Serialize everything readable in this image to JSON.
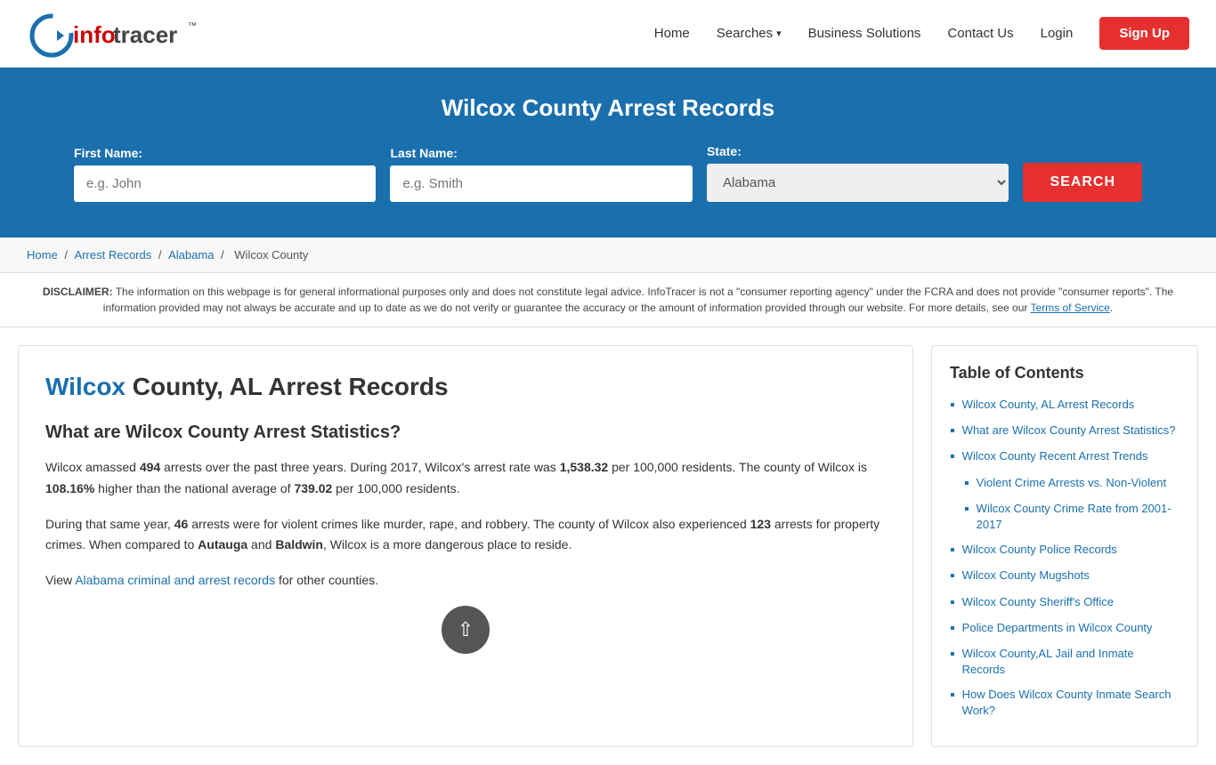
{
  "header": {
    "logo_text_info": "info",
    "logo_text_tracer": "tracer",
    "logo_tm": "™",
    "nav": {
      "home": "Home",
      "searches": "Searches",
      "business_solutions": "Business Solutions",
      "contact_us": "Contact Us",
      "login": "Login",
      "signup": "Sign Up"
    }
  },
  "hero": {
    "title": "Wilcox County Arrest Records",
    "form": {
      "first_name_label": "First Name:",
      "first_name_placeholder": "e.g. John",
      "last_name_label": "Last Name:",
      "last_name_placeholder": "e.g. Smith",
      "state_label": "State:",
      "state_default": "Alabama",
      "search_button": "SEARCH"
    }
  },
  "breadcrumb": {
    "home": "Home",
    "arrest_records": "Arrest Records",
    "alabama": "Alabama",
    "wilcox_county": "Wilcox County"
  },
  "disclaimer": {
    "label": "DISCLAIMER:",
    "text": "The information on this webpage is for general informational purposes only and does not constitute legal advice. InfoTracer is not a \"consumer reporting agency\" under the FCRA and does not provide \"consumer reports\". The information provided may not always be accurate and up to date as we do not verify or guarantee the accuracy or the amount of information provided through our website. For more details, see our",
    "tos_link": "Terms of Service",
    "period": "."
  },
  "article": {
    "title_highlight": "Wilcox",
    "title_rest": " County, AL Arrest Records",
    "section1_title": "What are Wilcox County Arrest Statistics?",
    "section1_p1_pre": "Wilcox amassed ",
    "section1_arrests": "494",
    "section1_p1_mid1": " arrests over the past three years. During 2017, Wilcox's arrest rate was ",
    "section1_rate": "1,538.32",
    "section1_p1_mid2": " per 100,000 residents. The county of Wilcox is ",
    "section1_pct": "108.16%",
    "section1_p1_mid3": " higher than the national average of ",
    "section1_national": "739.02",
    "section1_p1_end": " per 100,000 residents.",
    "section1_p2_pre": "During that same year, ",
    "section1_violent": "46",
    "section1_p2_mid": " arrests were for violent crimes like murder, rape, and robbery. The county of Wilcox also experienced ",
    "section1_property": "123",
    "section1_p2_mid2": " arrests for property crimes. When compared to ",
    "section1_city1": "Autauga",
    "section1_p2_mid3": " and ",
    "section1_city2": "Baldwin",
    "section1_p2_end": ", Wilcox is a more dangerous place to reside.",
    "section1_p3_pre": "View ",
    "section1_link_text": "Alabama criminal and arrest records",
    "section1_p3_end": " for other counties."
  },
  "toc": {
    "title": "Table of Contents",
    "items": [
      {
        "label": "Wilcox County, AL Arrest Records",
        "sub": false
      },
      {
        "label": "What are Wilcox County Arrest Statistics?",
        "sub": false
      },
      {
        "label": "Wilcox County Recent Arrest Trends",
        "sub": false
      },
      {
        "label": "Violent Crime Arrests vs. Non-Violent",
        "sub": true
      },
      {
        "label": "Wilcox County Crime Rate from 2001-2017",
        "sub": true
      },
      {
        "label": "Wilcox County Police Records",
        "sub": false
      },
      {
        "label": "Wilcox County Mugshots",
        "sub": false
      },
      {
        "label": "Wilcox County Sheriff's Office",
        "sub": false
      },
      {
        "label": "Police Departments in Wilcox County",
        "sub": false
      },
      {
        "label": "Wilcox County,AL Jail and Inmate Records",
        "sub": false
      },
      {
        "label": "How Does Wilcox County Inmate Search Work?",
        "sub": false
      }
    ]
  }
}
